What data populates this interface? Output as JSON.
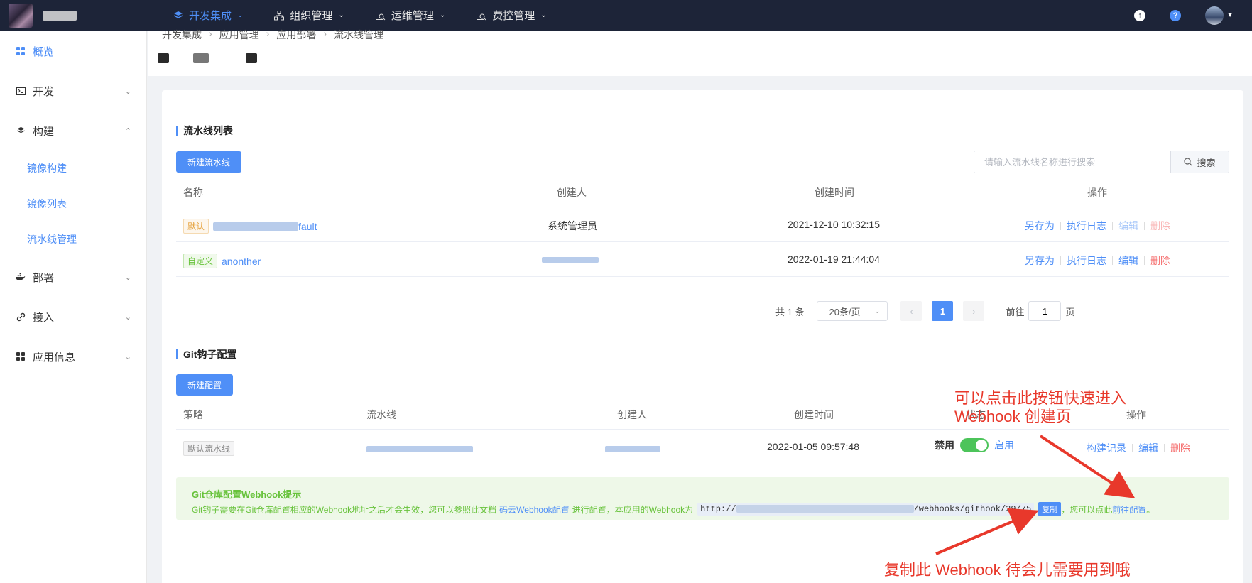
{
  "topnav": {
    "items": [
      {
        "label": "开发集成",
        "icon": "layers-icon",
        "active": true
      },
      {
        "label": "组织管理",
        "icon": "org-tree-icon",
        "active": false
      },
      {
        "label": "运维管理",
        "icon": "monitor-search-icon",
        "active": false
      },
      {
        "label": "费控管理",
        "icon": "cost-search-icon",
        "active": false
      }
    ],
    "right_icons": [
      "upload-icon",
      "help-icon",
      "avatar"
    ]
  },
  "sidebar": {
    "items": [
      {
        "label": "概览",
        "icon": "grid-icon",
        "active": true
      },
      {
        "label": "开发",
        "icon": "terminal-icon"
      },
      {
        "label": "构建",
        "icon": "layers-icon"
      },
      {
        "label": "部署",
        "icon": "docker-icon"
      },
      {
        "label": "接入",
        "icon": "link-icon"
      },
      {
        "label": "应用信息",
        "icon": "grid-icon"
      }
    ],
    "build_sub": [
      "镜像构建",
      "镜像列表",
      "流水线管理"
    ]
  },
  "breadcrumb": [
    "开发集成",
    "应用管理",
    "应用部署",
    "流水线管理"
  ],
  "pipelines": {
    "title": "流水线列表",
    "new_button": "新建流水线",
    "search_placeholder": "请输入流水线名称进行搜索",
    "search_button": "搜索",
    "columns": [
      "名称",
      "创建人",
      "创建时间",
      "操作"
    ],
    "rows": [
      {
        "tag": "默认",
        "name_suffix": "fault",
        "creator": "系统管理员",
        "created": "2021-12-10 10:32:15"
      },
      {
        "tag": "自定义",
        "name": "anonther",
        "creator": "",
        "created": "2022-01-19 21:44:04"
      }
    ],
    "ops": {
      "save_as": "另存为",
      "logs": "执行日志",
      "edit": "编辑",
      "delete": "删除"
    }
  },
  "pagination": {
    "total": "共 1 条",
    "page_size": "20条/页",
    "current": "1",
    "goto_label": "前往",
    "goto_value": "1",
    "page_unit": "页"
  },
  "hooks": {
    "title": "Git钩子配置",
    "new_button": "新建配置",
    "columns": [
      "策略",
      "流水线",
      "创建人",
      "创建时间",
      "状态",
      "操作"
    ],
    "row": {
      "strategy": "默认流水线",
      "created": "2022-01-05 09:57:48",
      "status_off": "禁用",
      "status_on": "启用",
      "enabled": true
    },
    "ops": {
      "records": "构建记录",
      "edit": "编辑",
      "delete": "删除"
    }
  },
  "alert": {
    "title": "Git仓库配置Webhook提示",
    "text_before": "Git钩子需要在Git仓库配置相应的Webhook地址之后才会生效，您可以参照此文档",
    "doc_link": "码云Webhook配置",
    "text_mid": "进行配置，本应用的Webhook为",
    "url_prefix": "http://",
    "url_suffix": "/webhooks/githook/29/75",
    "copy": "复制",
    "text_after": "，您可以点此",
    "goto_link": "前往配置",
    "text_end": "。"
  },
  "annotations": {
    "top_line1": "可以点击此按钮快速进入",
    "top_line2": "Webhook 创建页",
    "bottom": "复制此 Webhook 待会儿需要用到哦"
  }
}
